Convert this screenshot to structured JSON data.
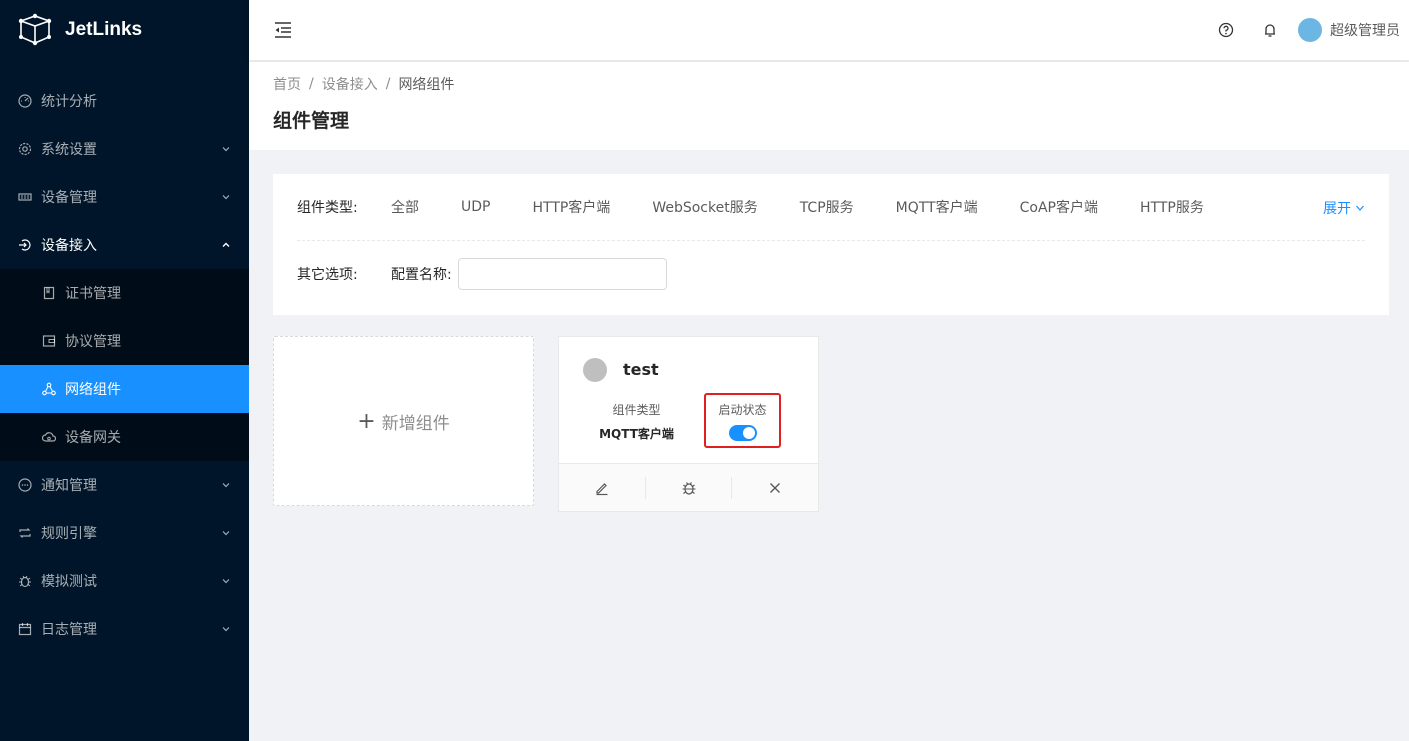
{
  "app": {
    "name": "JetLinks"
  },
  "sidebar": {
    "items": [
      {
        "label": "统计分析",
        "icon": "dashboard-icon"
      },
      {
        "label": "系统设置",
        "icon": "setting-icon"
      },
      {
        "label": "设备管理",
        "icon": "device-icon"
      },
      {
        "label": "设备接入",
        "icon": "login-icon",
        "open": true,
        "children": [
          {
            "label": "证书管理",
            "icon": "book-icon"
          },
          {
            "label": "协议管理",
            "icon": "wallet-icon"
          },
          {
            "label": "网络组件",
            "icon": "deployment-unit-icon",
            "active": true
          },
          {
            "label": "设备网关",
            "icon": "cloud-icon"
          }
        ]
      },
      {
        "label": "通知管理",
        "icon": "message-icon"
      },
      {
        "label": "规则引擎",
        "icon": "retweet-icon"
      },
      {
        "label": "模拟测试",
        "icon": "bug-icon"
      },
      {
        "label": "日志管理",
        "icon": "calendar-icon"
      }
    ]
  },
  "header": {
    "username": "超级管理员"
  },
  "breadcrumb": [
    "首页",
    "设备接入",
    "网络组件"
  ],
  "page_title": "组件管理",
  "filter": {
    "type_label": "组件类型:",
    "types": [
      "全部",
      "UDP",
      "HTTP客户端",
      "WebSocket服务",
      "TCP服务",
      "MQTT客户端",
      "CoAP客户端",
      "HTTP服务"
    ],
    "expand_label": "展开",
    "other_label": "其它选项:",
    "config_name_label": "配置名称:",
    "config_name_value": ""
  },
  "new_card": {
    "label": "新增组件"
  },
  "component_card": {
    "title": "test",
    "type_key": "组件类型",
    "type_value": "MQTT客户端",
    "status_key": "启动状态",
    "status_on": true,
    "accent": "#1890ff"
  }
}
